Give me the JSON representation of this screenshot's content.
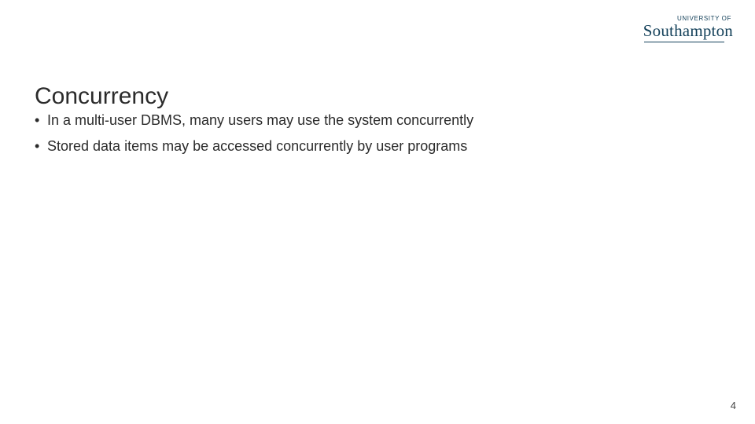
{
  "logo": {
    "prefix": "UNIVERSITY OF",
    "wordmark_under": "Southampto",
    "wordmark_tail": "n"
  },
  "title": "Concurrency",
  "bullets": [
    "In a multi-user DBMS, many users may use the system concurrently",
    "Stored data items may be accessed concurrently by user programs"
  ],
  "page_number": "4"
}
